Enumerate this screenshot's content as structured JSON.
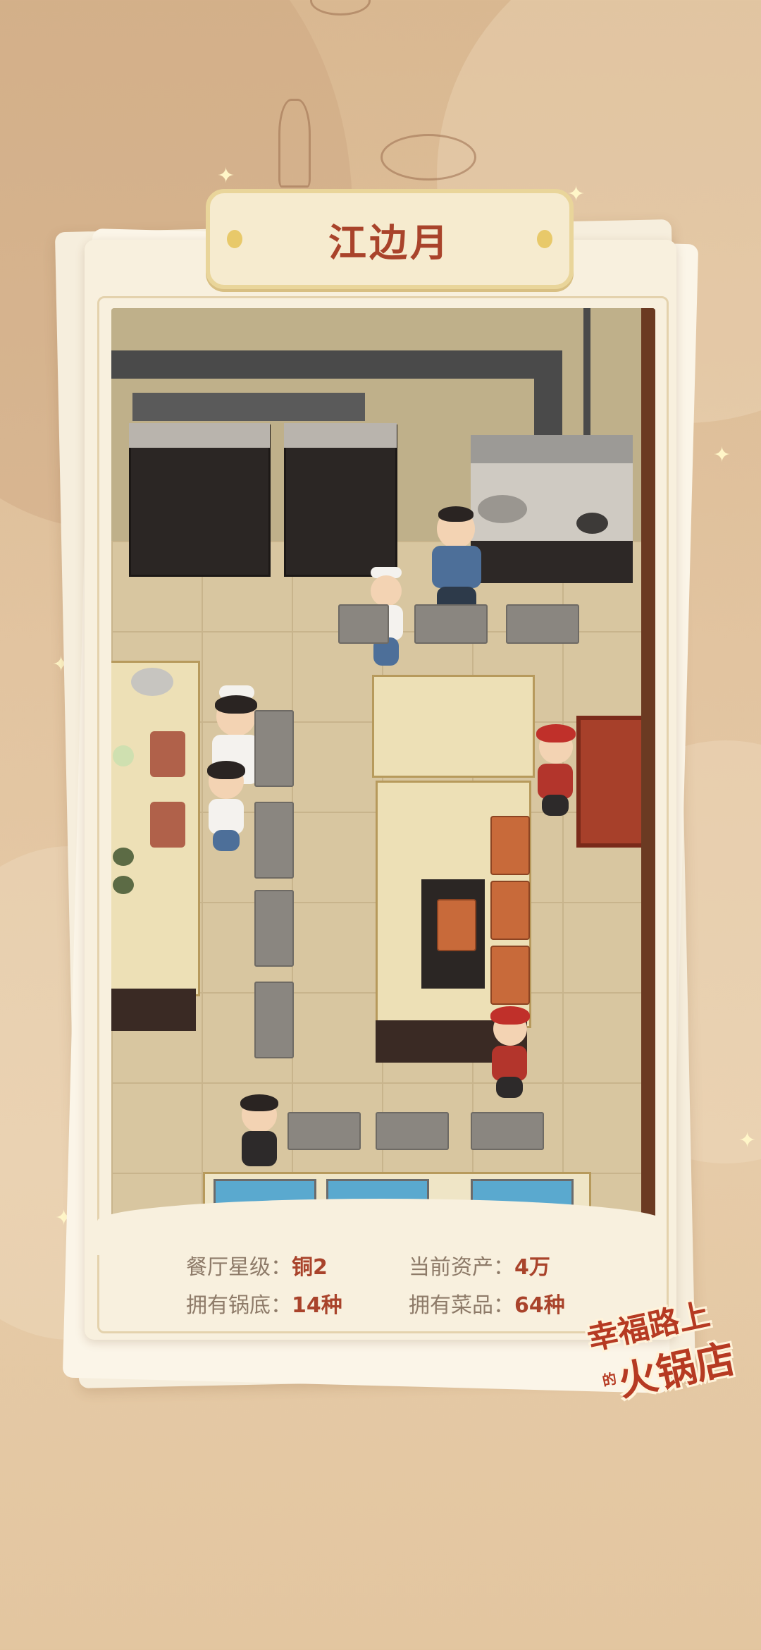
{
  "restaurant_title": "江边月",
  "stats": {
    "star_level_label": "餐厅星级：",
    "star_level_value": "铜2",
    "assets_label": "当前资产：",
    "assets_value": "4万",
    "soup_base_label": "拥有锅底：",
    "soup_base_value": "14种",
    "dishes_label": "拥有菜品：",
    "dishes_value": "64种"
  },
  "logo": {
    "line1": "幸福路上",
    "line2_small": "的",
    "line2": "火锅店"
  },
  "colors": {
    "accent_red": "#a9432b",
    "label_brown": "#8e7b69",
    "card_bg": "#f8f0de",
    "plaque_border": "#e9d59a"
  }
}
